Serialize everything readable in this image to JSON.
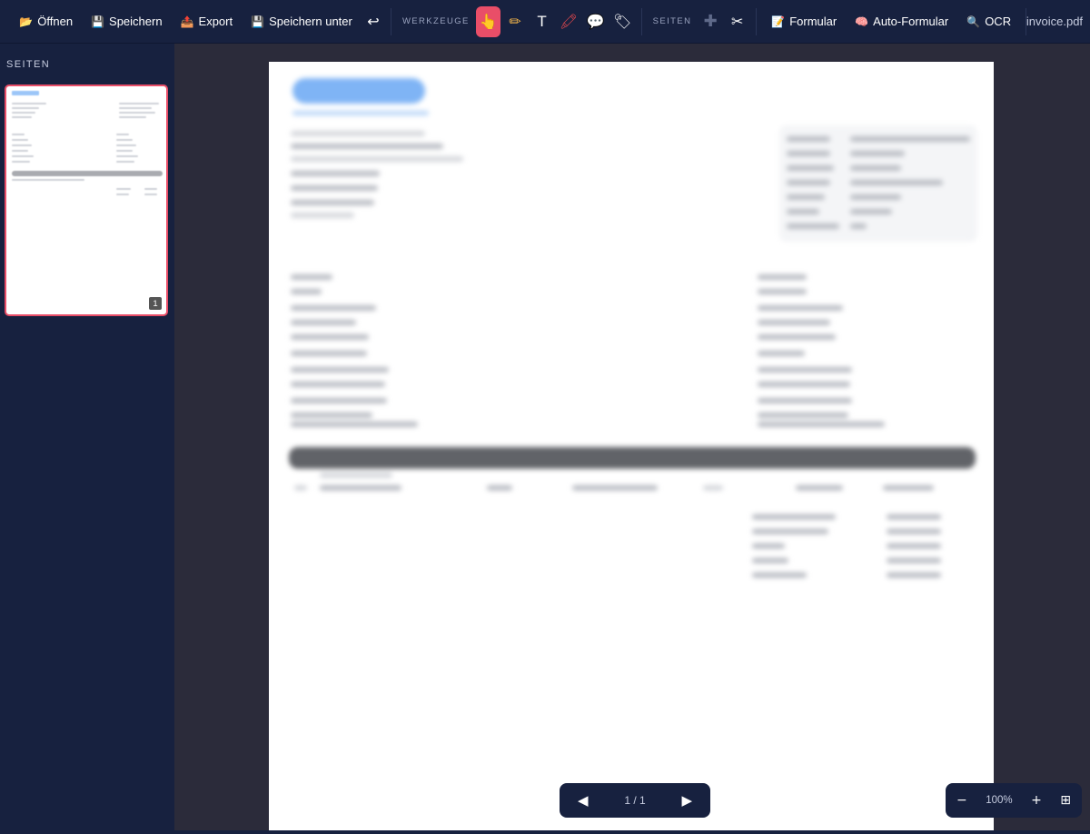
{
  "toolbar": {
    "open_label": "Öffnen",
    "save_label": "Speichern",
    "export_label": "Export",
    "save_as_label": "Speichern unter",
    "tools_section": "WERKZEUGE",
    "pages_section": "SEITEN",
    "form_label": "Formular",
    "auto_form_label": "Auto-Formular",
    "ocr_label": "OCR",
    "filename": "invoice.pdf",
    "active_tool": "select",
    "icons": {
      "open": "folder-icon",
      "save": "floppy-disk-icon",
      "export": "export-tray-icon",
      "save_as": "floppy-disk-icon",
      "undo": "undo-icon",
      "select": "pointing-hand-icon",
      "draw": "pencil-icon",
      "text": "text-icon",
      "highlight": "marker-icon",
      "comment": "speech-bubble-icon",
      "stamp": "tag-icon",
      "add_page": "plus-icon",
      "cut": "scissors-icon",
      "form": "memo-icon",
      "auto_form": "brain-icon",
      "ocr": "magnifier-icon"
    },
    "colors": {
      "accent": "#e94e68",
      "bar": "#17213f"
    }
  },
  "sidebar": {
    "title": "SEITEN",
    "thumbnails": [
      {
        "page_number": "1",
        "selected": true
      }
    ]
  },
  "pager": {
    "info": "1 / 1",
    "icons": {
      "prev": "triangle-left-icon",
      "next": "triangle-right-icon"
    }
  },
  "zoom": {
    "level": "100%",
    "icons": {
      "out": "minus-icon",
      "in": "plus-icon",
      "fit": "grid-fit-icon"
    }
  }
}
